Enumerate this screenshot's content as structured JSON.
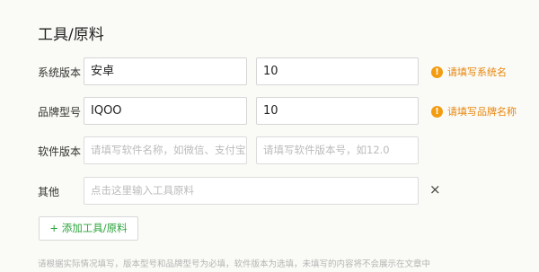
{
  "section": {
    "title": "工具/原料"
  },
  "rows": [
    {
      "label": "系统版本",
      "name_value": "安卓",
      "version_value": "10",
      "warning": "请填写系统名"
    },
    {
      "label": "品牌型号",
      "name_value": "IQOO",
      "version_value": "10",
      "warning": "请填写品牌名称"
    },
    {
      "label": "软件版本",
      "name_placeholder": "请填写软件名称，如微信、支付宝",
      "version_placeholder": "请填写软件版本号，如12.0"
    },
    {
      "label": "其他",
      "placeholder": "点击这里输入工具原料",
      "close_symbol": "×"
    }
  ],
  "add_button": {
    "label": "+ 添加工具/原料"
  },
  "footnote": "请根据实际情况填写，版本型号和品牌型号为必填，软件版本为选填，未填写的内容将不会展示在文章中",
  "colors": {
    "accent": "#2aa33a",
    "warning": "#e8860c",
    "background": "#fafaf6"
  },
  "icons": {
    "warning": "exclamation-circle-icon",
    "close": "close-icon"
  }
}
